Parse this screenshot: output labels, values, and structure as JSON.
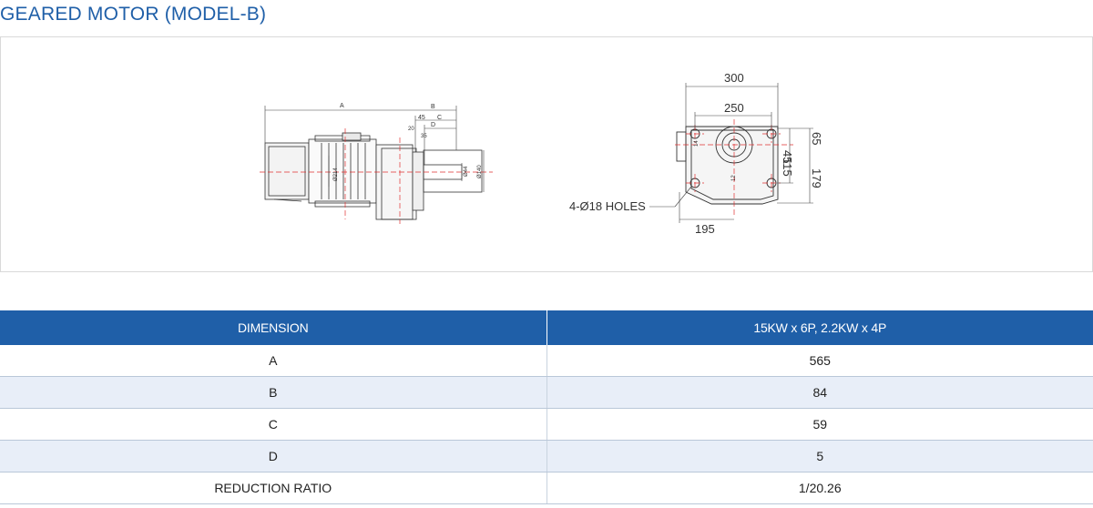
{
  "page": {
    "title": "GEARED MOTOR (MODEL-B)"
  },
  "side_view": {
    "labels": {
      "a": "A",
      "b": "B",
      "c": "C",
      "d": "D",
      "n45": "45",
      "n20": "20",
      "n35": "35",
      "phi44": "Ø44",
      "phi140": "Ø140",
      "phi214": "Ø214"
    }
  },
  "front_view": {
    "dims": {
      "width_total": "300",
      "width_holes": "250",
      "v45": "45",
      "v65": "65",
      "v115": "115",
      "v179": "179",
      "w195": "195",
      "v14": "14",
      "v12": "12"
    },
    "holes_note": "4-Ø18 HOLES"
  },
  "spec_table": {
    "headers": [
      "DIMENSION",
      "15KW x 6P, 2.2KW x 4P"
    ],
    "rows": [
      {
        "dimension": "A",
        "value": "565"
      },
      {
        "dimension": "B",
        "value": "84"
      },
      {
        "dimension": "C",
        "value": "59"
      },
      {
        "dimension": "D",
        "value": "5"
      },
      {
        "dimension": "REDUCTION RATIO",
        "value": "1/20.26"
      }
    ]
  },
  "colors": {
    "accent": "#1f5fa8",
    "row_alt": "#e8eef8",
    "centerline": "#e03030"
  }
}
